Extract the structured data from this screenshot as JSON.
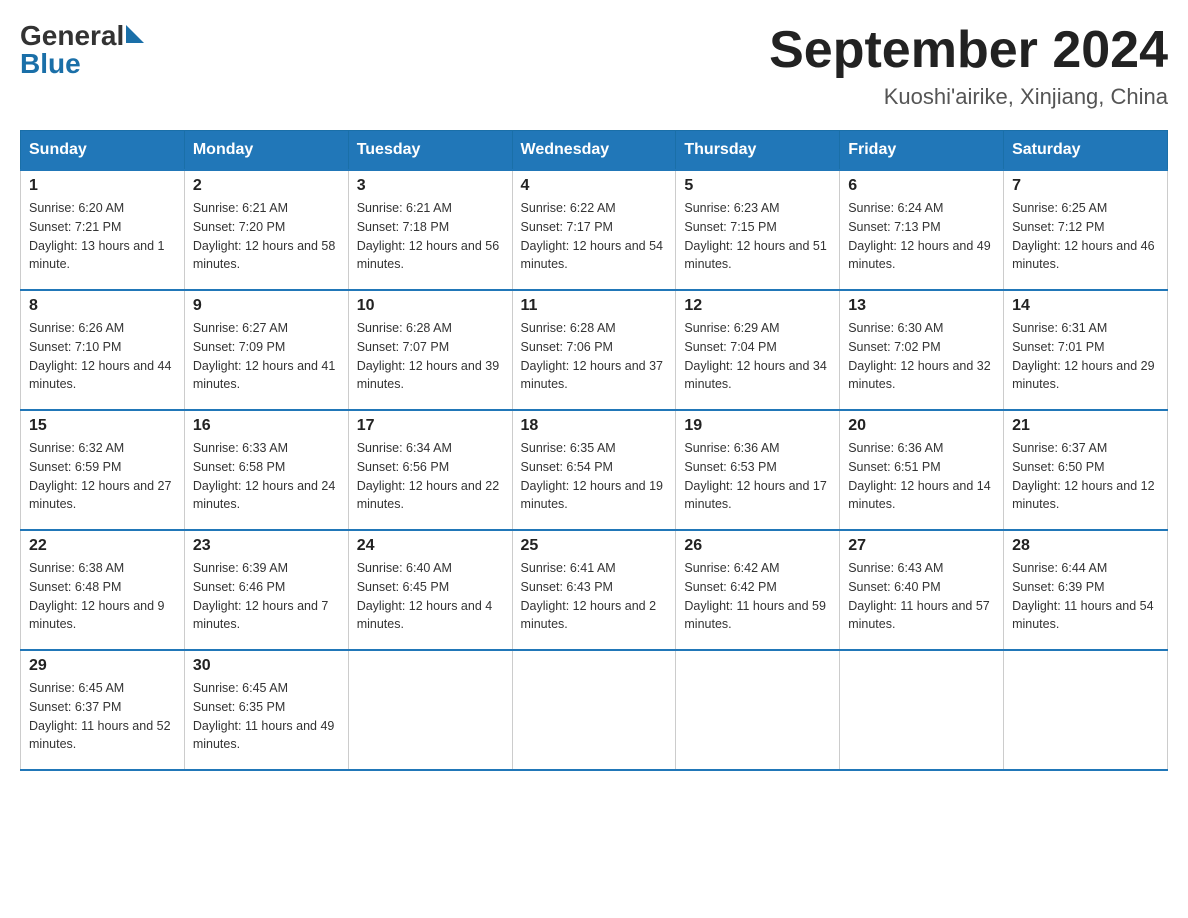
{
  "header": {
    "logo_general": "General",
    "logo_blue": "Blue",
    "title": "September 2024",
    "subtitle": "Kuoshi'airike, Xinjiang, China"
  },
  "weekdays": [
    "Sunday",
    "Monday",
    "Tuesday",
    "Wednesday",
    "Thursday",
    "Friday",
    "Saturday"
  ],
  "weeks": [
    [
      {
        "day": "1",
        "sunrise": "6:20 AM",
        "sunset": "7:21 PM",
        "daylight": "13 hours and 1 minute."
      },
      {
        "day": "2",
        "sunrise": "6:21 AM",
        "sunset": "7:20 PM",
        "daylight": "12 hours and 58 minutes."
      },
      {
        "day": "3",
        "sunrise": "6:21 AM",
        "sunset": "7:18 PM",
        "daylight": "12 hours and 56 minutes."
      },
      {
        "day": "4",
        "sunrise": "6:22 AM",
        "sunset": "7:17 PM",
        "daylight": "12 hours and 54 minutes."
      },
      {
        "day": "5",
        "sunrise": "6:23 AM",
        "sunset": "7:15 PM",
        "daylight": "12 hours and 51 minutes."
      },
      {
        "day": "6",
        "sunrise": "6:24 AM",
        "sunset": "7:13 PM",
        "daylight": "12 hours and 49 minutes."
      },
      {
        "day": "7",
        "sunrise": "6:25 AM",
        "sunset": "7:12 PM",
        "daylight": "12 hours and 46 minutes."
      }
    ],
    [
      {
        "day": "8",
        "sunrise": "6:26 AM",
        "sunset": "7:10 PM",
        "daylight": "12 hours and 44 minutes."
      },
      {
        "day": "9",
        "sunrise": "6:27 AM",
        "sunset": "7:09 PM",
        "daylight": "12 hours and 41 minutes."
      },
      {
        "day": "10",
        "sunrise": "6:28 AM",
        "sunset": "7:07 PM",
        "daylight": "12 hours and 39 minutes."
      },
      {
        "day": "11",
        "sunrise": "6:28 AM",
        "sunset": "7:06 PM",
        "daylight": "12 hours and 37 minutes."
      },
      {
        "day": "12",
        "sunrise": "6:29 AM",
        "sunset": "7:04 PM",
        "daylight": "12 hours and 34 minutes."
      },
      {
        "day": "13",
        "sunrise": "6:30 AM",
        "sunset": "7:02 PM",
        "daylight": "12 hours and 32 minutes."
      },
      {
        "day": "14",
        "sunrise": "6:31 AM",
        "sunset": "7:01 PM",
        "daylight": "12 hours and 29 minutes."
      }
    ],
    [
      {
        "day": "15",
        "sunrise": "6:32 AM",
        "sunset": "6:59 PM",
        "daylight": "12 hours and 27 minutes."
      },
      {
        "day": "16",
        "sunrise": "6:33 AM",
        "sunset": "6:58 PM",
        "daylight": "12 hours and 24 minutes."
      },
      {
        "day": "17",
        "sunrise": "6:34 AM",
        "sunset": "6:56 PM",
        "daylight": "12 hours and 22 minutes."
      },
      {
        "day": "18",
        "sunrise": "6:35 AM",
        "sunset": "6:54 PM",
        "daylight": "12 hours and 19 minutes."
      },
      {
        "day": "19",
        "sunrise": "6:36 AM",
        "sunset": "6:53 PM",
        "daylight": "12 hours and 17 minutes."
      },
      {
        "day": "20",
        "sunrise": "6:36 AM",
        "sunset": "6:51 PM",
        "daylight": "12 hours and 14 minutes."
      },
      {
        "day": "21",
        "sunrise": "6:37 AM",
        "sunset": "6:50 PM",
        "daylight": "12 hours and 12 minutes."
      }
    ],
    [
      {
        "day": "22",
        "sunrise": "6:38 AM",
        "sunset": "6:48 PM",
        "daylight": "12 hours and 9 minutes."
      },
      {
        "day": "23",
        "sunrise": "6:39 AM",
        "sunset": "6:46 PM",
        "daylight": "12 hours and 7 minutes."
      },
      {
        "day": "24",
        "sunrise": "6:40 AM",
        "sunset": "6:45 PM",
        "daylight": "12 hours and 4 minutes."
      },
      {
        "day": "25",
        "sunrise": "6:41 AM",
        "sunset": "6:43 PM",
        "daylight": "12 hours and 2 minutes."
      },
      {
        "day": "26",
        "sunrise": "6:42 AM",
        "sunset": "6:42 PM",
        "daylight": "11 hours and 59 minutes."
      },
      {
        "day": "27",
        "sunrise": "6:43 AM",
        "sunset": "6:40 PM",
        "daylight": "11 hours and 57 minutes."
      },
      {
        "day": "28",
        "sunrise": "6:44 AM",
        "sunset": "6:39 PM",
        "daylight": "11 hours and 54 minutes."
      }
    ],
    [
      {
        "day": "29",
        "sunrise": "6:45 AM",
        "sunset": "6:37 PM",
        "daylight": "11 hours and 52 minutes."
      },
      {
        "day": "30",
        "sunrise": "6:45 AM",
        "sunset": "6:35 PM",
        "daylight": "11 hours and 49 minutes."
      },
      null,
      null,
      null,
      null,
      null
    ]
  ]
}
